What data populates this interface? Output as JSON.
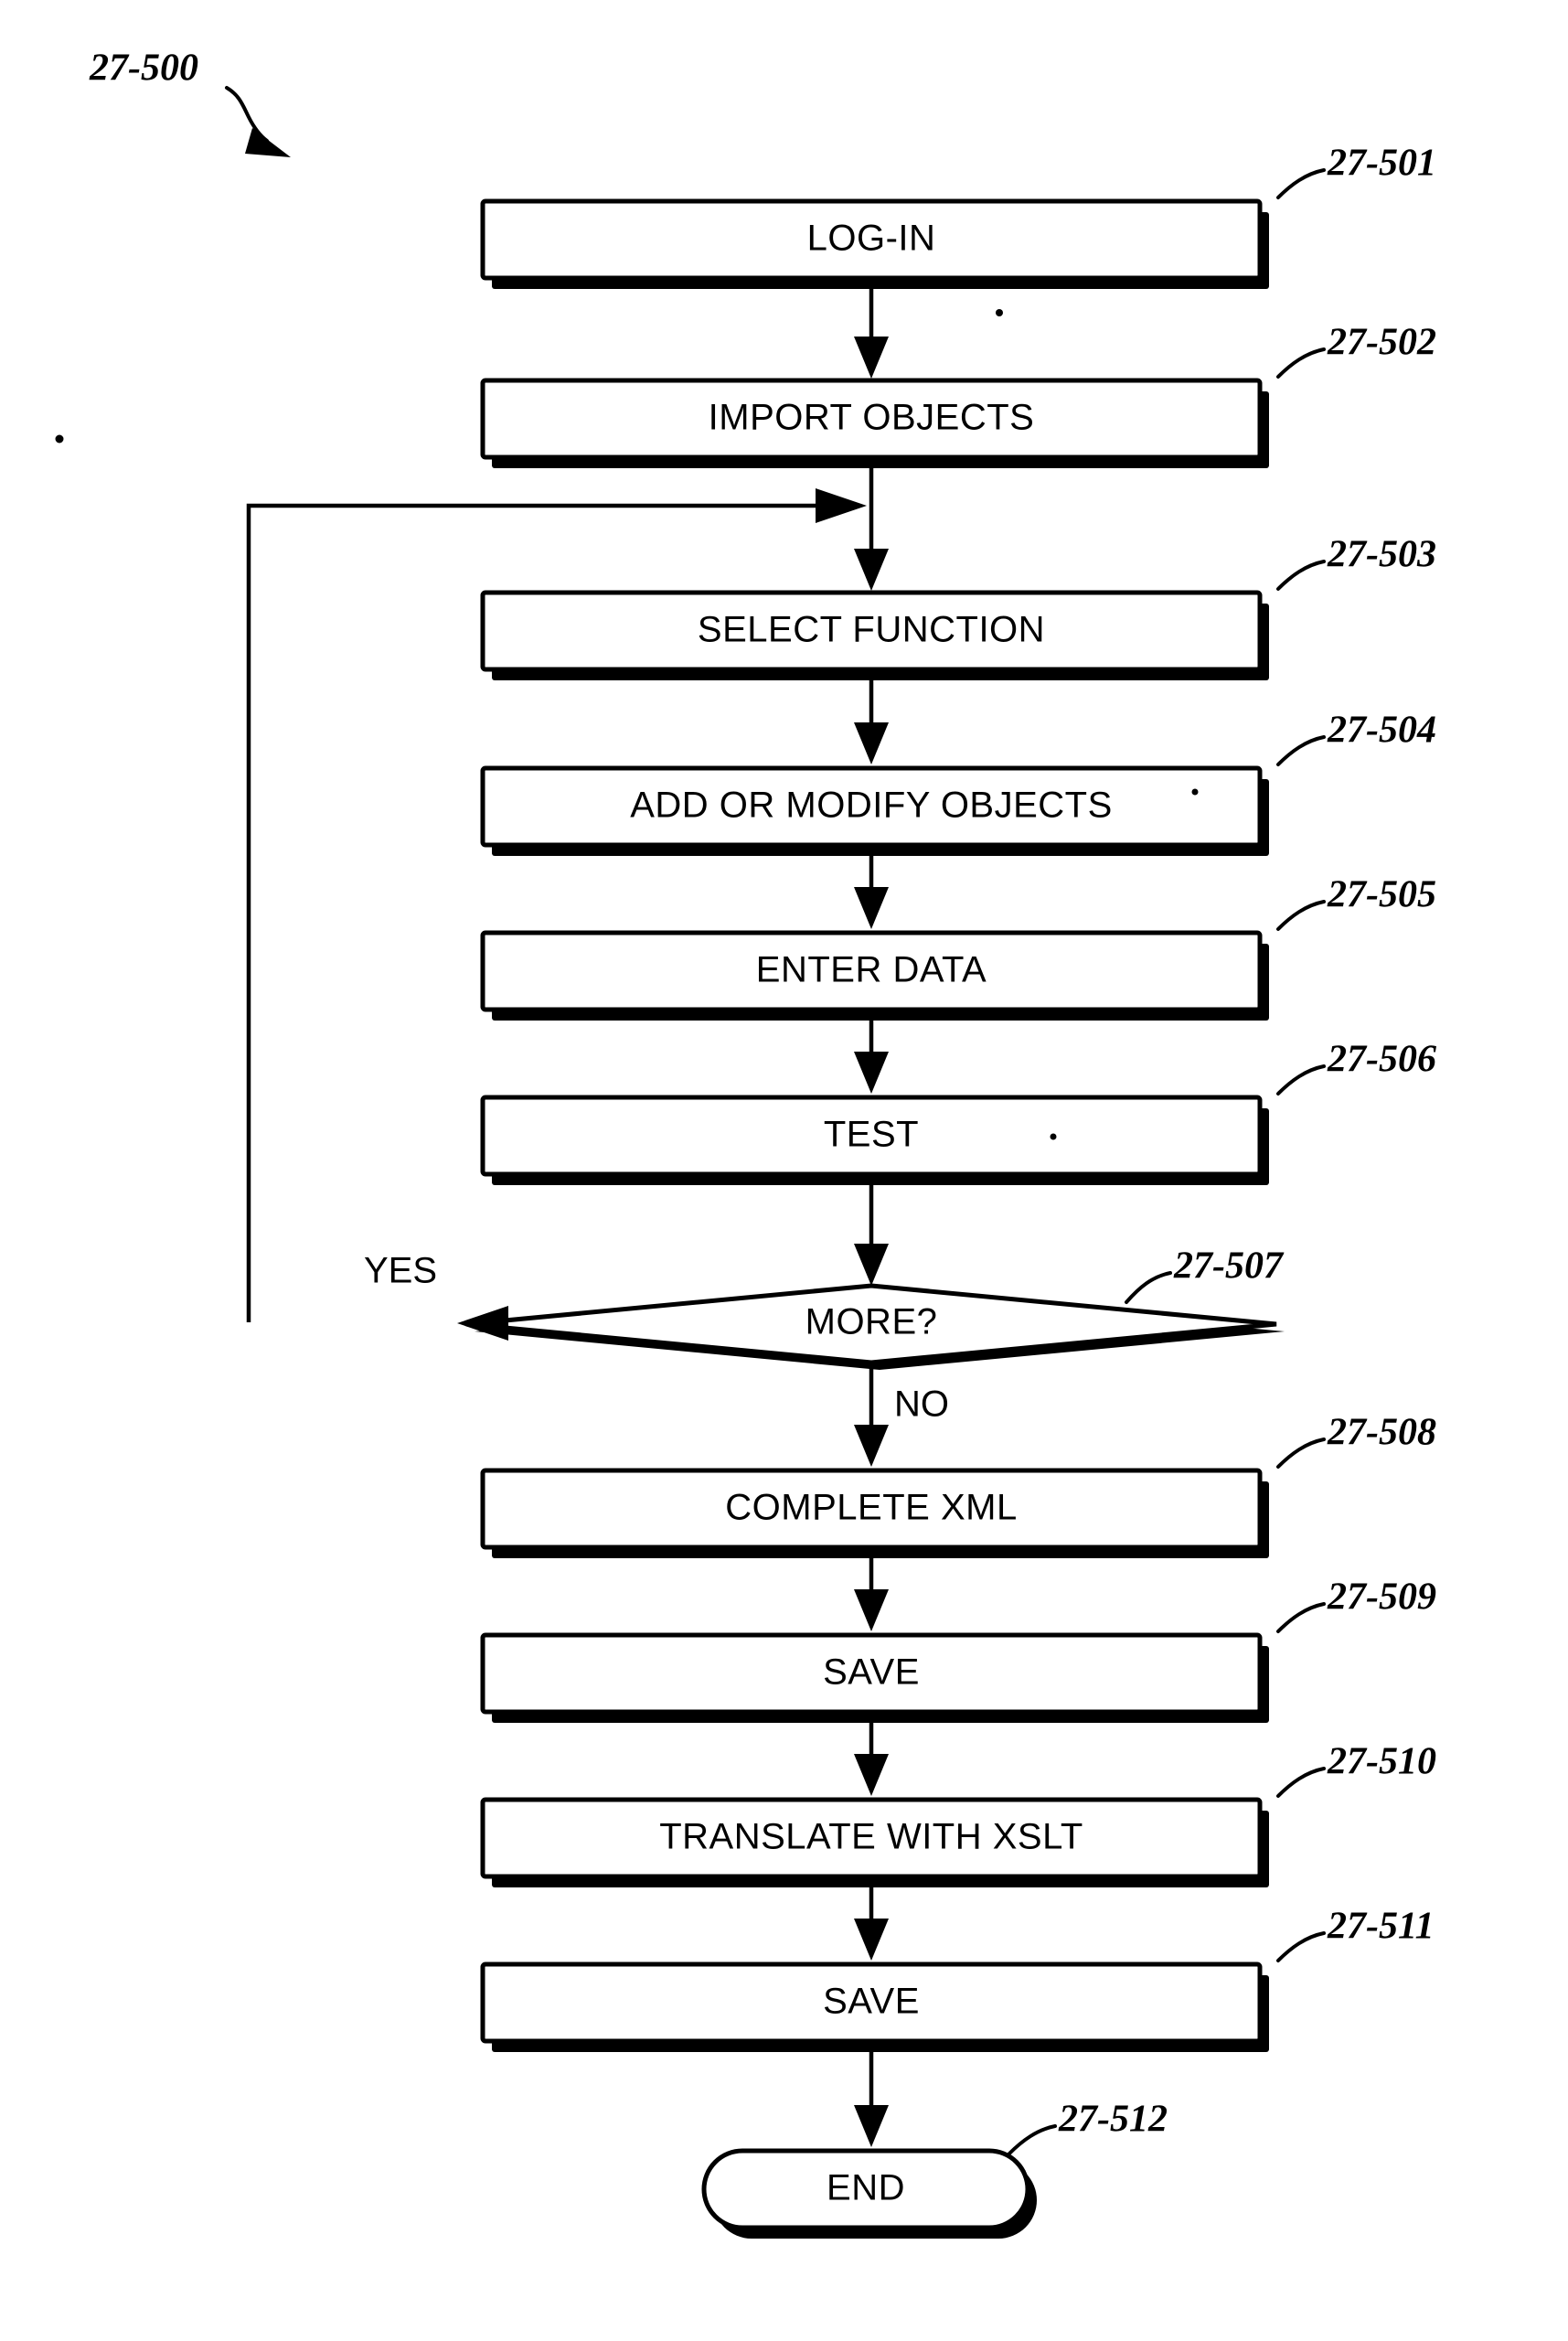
{
  "figure": {
    "label": "27-500",
    "type": "flowchart",
    "title_present": false
  },
  "nodes": [
    {
      "id": "n1",
      "ref": "27-501",
      "label": "LOG-IN",
      "shape": "process"
    },
    {
      "id": "n2",
      "ref": "27-502",
      "label": "IMPORT OBJECTS",
      "shape": "process"
    },
    {
      "id": "n3",
      "ref": "27-503",
      "label": "SELECT FUNCTION",
      "shape": "process"
    },
    {
      "id": "n4",
      "ref": "27-504",
      "label": "ADD OR MODIFY OBJECTS",
      "shape": "process"
    },
    {
      "id": "n5",
      "ref": "27-505",
      "label": "ENTER DATA",
      "shape": "process"
    },
    {
      "id": "n6",
      "ref": "27-506",
      "label": "TEST",
      "shape": "process"
    },
    {
      "id": "n7",
      "ref": "27-507",
      "label": "MORE?",
      "shape": "decision"
    },
    {
      "id": "n8",
      "ref": "27-508",
      "label": "COMPLETE XML",
      "shape": "process"
    },
    {
      "id": "n9",
      "ref": "27-509",
      "label": "SAVE",
      "shape": "process"
    },
    {
      "id": "n10",
      "ref": "27-510",
      "label": "TRANSLATE WITH XSLT",
      "shape": "process"
    },
    {
      "id": "n11",
      "ref": "27-511",
      "label": "SAVE",
      "shape": "process"
    },
    {
      "id": "n12",
      "ref": "27-512",
      "label": "END",
      "shape": "terminator"
    }
  ],
  "branch_labels": {
    "yes": "YES",
    "no": "NO"
  },
  "colors": {
    "ink": "#000000",
    "paper": "#ffffff"
  }
}
